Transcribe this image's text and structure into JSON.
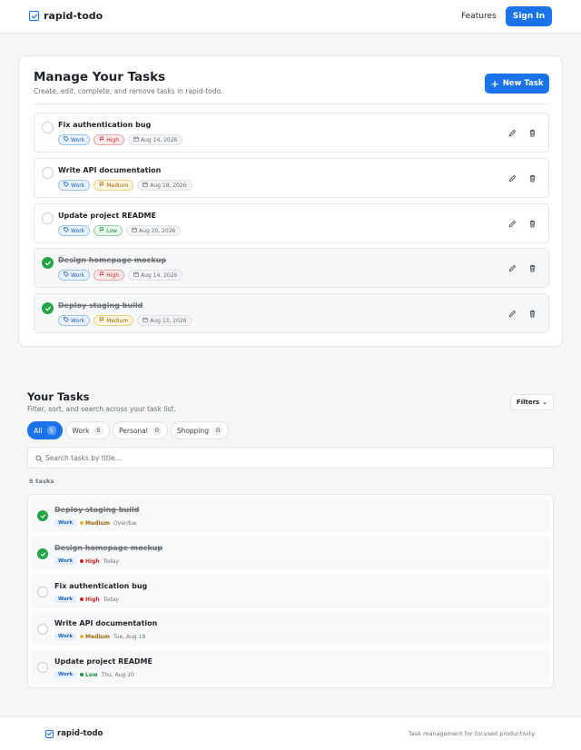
{
  "header": {
    "brand": "rapid-todo",
    "nav_features": "Features",
    "signin": "Sign In"
  },
  "manage": {
    "title": "Manage Your Tasks",
    "subtitle": "Create, edit, complete, and remove tasks in rapid-todo.",
    "new_task": "New Task",
    "tasks": [
      {
        "title": "Fix authentication bug",
        "category": "Work",
        "priority": "High",
        "date": "Aug 14, 2026",
        "done": false
      },
      {
        "title": "Write API documentation",
        "category": "Work",
        "priority": "Medium",
        "date": "Aug 18, 2026",
        "done": false
      },
      {
        "title": "Update project README",
        "category": "Work",
        "priority": "Low",
        "date": "Aug 20, 2026",
        "done": false
      },
      {
        "title": "Design homepage mockup",
        "category": "Work",
        "priority": "High",
        "date": "Aug 14, 2026",
        "done": true
      },
      {
        "title": "Deploy staging build",
        "category": "Work",
        "priority": "Medium",
        "date": "Aug 13, 2026",
        "done": true
      }
    ]
  },
  "your_tasks": {
    "title": "Your Tasks",
    "subtitle": "Filter, sort, and search across your task list.",
    "filters_label": "Filters",
    "chips": [
      {
        "label": "All",
        "count": "5",
        "active": true
      },
      {
        "label": "Work",
        "count": "5",
        "active": false
      },
      {
        "label": "Personal",
        "count": "0",
        "active": false
      },
      {
        "label": "Shopping",
        "count": "0",
        "active": false
      }
    ],
    "search_placeholder": "Search tasks by title...",
    "count_label": "5 tasks",
    "list": [
      {
        "title": "Deploy staging build",
        "category": "Work",
        "priority": "Medium",
        "due": "Overdue",
        "done": true
      },
      {
        "title": "Design homepage mockup",
        "category": "Work",
        "priority": "High",
        "due": "Today",
        "done": true
      },
      {
        "title": "Fix authentication bug",
        "category": "Work",
        "priority": "High",
        "due": "Today",
        "done": false
      },
      {
        "title": "Write API documentation",
        "category": "Work",
        "priority": "Medium",
        "due": "Tue, Aug 18",
        "done": false
      },
      {
        "title": "Update project README",
        "category": "Work",
        "priority": "Low",
        "due": "Thu, Aug 20",
        "done": false
      }
    ]
  },
  "footer": {
    "brand": "rapid-todo",
    "tagline": "Task management for focused productivity."
  },
  "colors": {
    "accent": "#1a73e8",
    "done_green": "#22a447",
    "high": "#c62828",
    "medium": "#a1660b",
    "low": "#1e8e3e"
  },
  "icons": [
    "checkbox-logo-icon",
    "plus-icon",
    "tag-icon",
    "flag-icon",
    "calendar-icon",
    "pencil-icon",
    "trash-icon",
    "check-icon",
    "search-icon",
    "chevron-down-icon"
  ]
}
